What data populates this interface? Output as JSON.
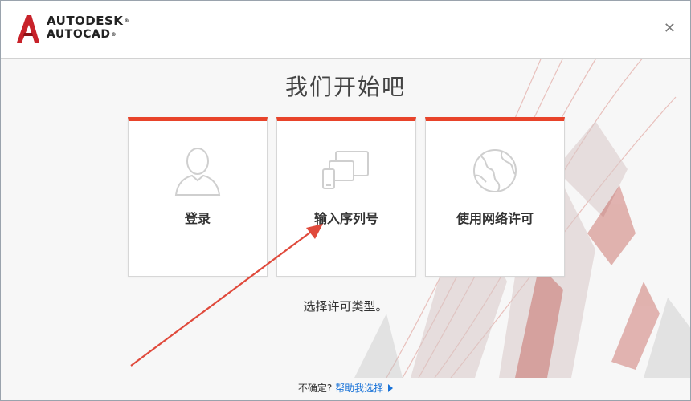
{
  "brand": {
    "line1": "AUTODESK",
    "line2": "AUTOCAD",
    "accent_color": "#e8432a"
  },
  "window": {
    "close_icon": "close-icon"
  },
  "main": {
    "title": "我们开始吧",
    "options": [
      {
        "label": "登录",
        "icon": "user-icon"
      },
      {
        "label": "输入序列号",
        "icon": "devices-icon"
      },
      {
        "label": "使用网络许可",
        "icon": "globe-icon"
      }
    ],
    "subtitle": "选择许可类型。"
  },
  "footer": {
    "question": "不确定?",
    "help_link": "帮助我选择"
  }
}
